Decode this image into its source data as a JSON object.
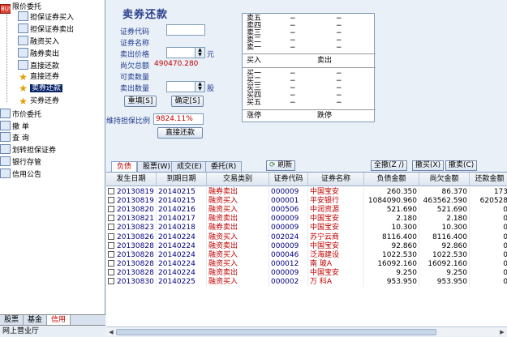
{
  "sidebar": {
    "items": [
      {
        "label": "限价委托",
        "level": 0,
        "icon": "red"
      },
      {
        "label": "担保证券买入",
        "level": 1
      },
      {
        "label": "担保证券卖出",
        "level": 1
      },
      {
        "label": "融资买入",
        "level": 1
      },
      {
        "label": "融券卖出",
        "level": 1
      },
      {
        "label": "直接还款",
        "level": 1
      },
      {
        "label": "直接还券",
        "level": 1
      },
      {
        "label": "卖券还款",
        "level": 1,
        "selected": true
      },
      {
        "label": "买券还券",
        "level": 1
      },
      {
        "label": "市价委托",
        "level": 0
      },
      {
        "label": "撤    单",
        "level": 0
      },
      {
        "label": "查    询",
        "level": 0
      },
      {
        "label": "划转担保证券",
        "level": 0
      },
      {
        "label": "银行存管",
        "level": 0
      },
      {
        "label": "信用公告",
        "level": 0
      }
    ],
    "bottom_tabs": [
      "股票",
      "基金",
      "信用"
    ],
    "active_bottom_tab": "信用",
    "bottom_title": "网上营业厅"
  },
  "form": {
    "title": "卖券还款",
    "code_label": "证券代码",
    "name_label": "证券名称",
    "price_label": "卖出价格",
    "price_unit": "元",
    "debt_label": "尚欠总额",
    "debt_value": "490470.280",
    "qty_avail_label": "可卖数量",
    "qty_label": "卖出数量",
    "qty_unit": "股",
    "reset_button": "重填[S]",
    "confirm_button": "确定[S]",
    "ratio_label": "维持担保比例",
    "ratio_value": "9824.11%",
    "direct_repay_button": "直接还款"
  },
  "quote": {
    "sell": [
      {
        "name": "卖五",
        "price": "−",
        "vol": "−"
      },
      {
        "name": "卖四",
        "price": "−",
        "vol": "−"
      },
      {
        "name": "卖三",
        "price": "−",
        "vol": "−"
      },
      {
        "name": "卖二",
        "price": "−",
        "vol": "−"
      },
      {
        "name": "卖一",
        "price": "−",
        "vol": "−"
      }
    ],
    "mid": {
      "buy": "买入",
      "sell": "卖出"
    },
    "buy": [
      {
        "name": "买一",
        "price": "−",
        "vol": "−"
      },
      {
        "name": "买二",
        "price": "−",
        "vol": "−"
      },
      {
        "name": "买三",
        "price": "−",
        "vol": "−"
      },
      {
        "name": "买四",
        "price": "−",
        "vol": "−"
      },
      {
        "name": "买五",
        "price": "−",
        "vol": "−"
      }
    ],
    "bottom": {
      "halt": "涨停",
      "limit_down": "跌停"
    }
  },
  "tabs": {
    "items": [
      "负债",
      "股票(W)",
      "成交(E)",
      "委托(R)"
    ],
    "active": "负债",
    "refresh": "刷新",
    "cancel_all": "全撤(Z /)",
    "cancel_buy": "撤买(X)",
    "cancel_sell": "撤卖(C)"
  },
  "table": {
    "headers": [
      "发生日期",
      "到期日期",
      "交易类别",
      "证券代码",
      "证券名称",
      "负债金额",
      "尚欠金额",
      "还款金额"
    ],
    "rows": [
      [
        "20130819",
        "20140215",
        "融券卖出",
        "000009",
        "中国宝安",
        "260.350",
        "86.370",
        "173"
      ],
      [
        "20130819",
        "20140215",
        "融资买入",
        "000001",
        "平安银行",
        "1084090.960",
        "463562.590",
        "620528"
      ],
      [
        "20130820",
        "20140216",
        "融资买入",
        "000506",
        "中润资源",
        "521.690",
        "521.690",
        "0"
      ],
      [
        "20130821",
        "20140217",
        "融资卖出",
        "000009",
        "中国宝安",
        "2.180",
        "2.180",
        "0"
      ],
      [
        "20130823",
        "20140218",
        "融券卖出",
        "000009",
        "中国宝安",
        "10.300",
        "10.300",
        "0"
      ],
      [
        "20130826",
        "20140224",
        "融资买入",
        "002024",
        "苏宁云商",
        "8116.400",
        "8116.400",
        "0"
      ],
      [
        "20130828",
        "20140224",
        "融资卖出",
        "000009",
        "中国宝安",
        "92.860",
        "92.860",
        "0"
      ],
      [
        "20130828",
        "20140224",
        "融资买入",
        "000046",
        "泛海建设",
        "1022.530",
        "1022.530",
        "0"
      ],
      [
        "20130828",
        "20140224",
        "融资买入",
        "000012",
        "南  玻A",
        "16092.160",
        "16092.160",
        "0"
      ],
      [
        "20130828",
        "20140224",
        "融资卖出",
        "000009",
        "中国宝安",
        "9.250",
        "9.250",
        "0"
      ],
      [
        "20130830",
        "20140225",
        "融资买入",
        "000002",
        "万  科A",
        "953.950",
        "953.950",
        "0"
      ]
    ]
  },
  "colors": {
    "accent": "#0a246a",
    "red_value": "#c00000",
    "label_blue": "#1e3a8a"
  }
}
